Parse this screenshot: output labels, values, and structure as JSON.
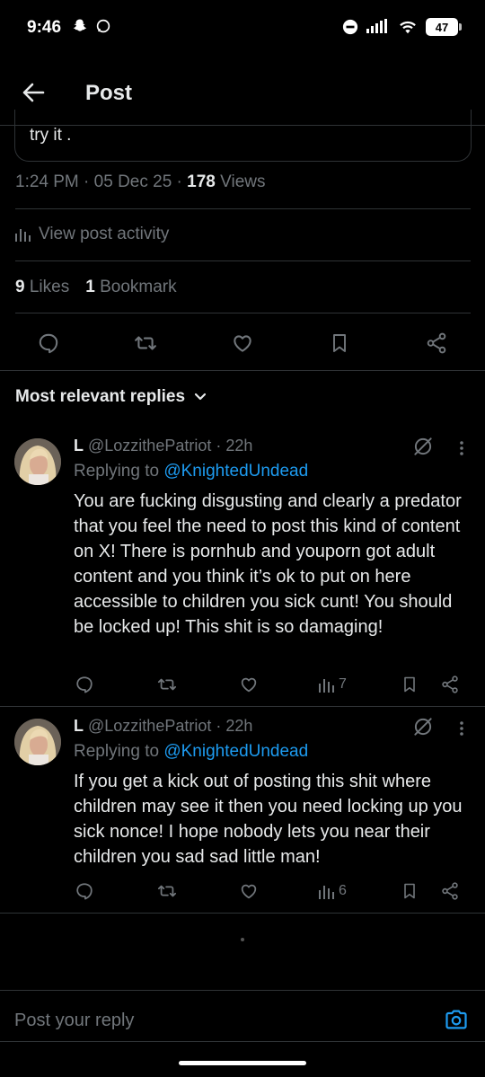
{
  "status_bar": {
    "time": "9:46",
    "battery": "47",
    "icons": [
      "snapchat-icon",
      "messenger-icon",
      "dnd-icon",
      "signal-icon",
      "wifi-icon",
      "battery-icon"
    ]
  },
  "header": {
    "title": "Post"
  },
  "post": {
    "text_tail": "try it .",
    "time": "1:24 PM",
    "date": "05 Dec 25",
    "views_count": "178",
    "views_label": "Views",
    "activity_label": "View post activity",
    "likes_count": "9",
    "likes_label": "Likes",
    "bookmarks_count": "1",
    "bookmarks_label": "Bookmark"
  },
  "replies_section": {
    "sort_label": "Most relevant replies"
  },
  "replies": [
    {
      "name": "L",
      "handle": "@LozzithePatriot",
      "time": "22h",
      "replying_prefix": "Replying to",
      "replying_to": "@KnightedUndead",
      "body": "You are fucking disgusting and clearly a predator that you feel the need to post this kind of content on X! There is pornhub and youporn got adult content and you think it’s ok to put on here accessible to children you sick cunt! You should be locked up! This shit is so damaging!",
      "views": "7"
    },
    {
      "name": "L",
      "handle": "@LozzithePatriot",
      "time": "22h",
      "replying_prefix": "Replying to",
      "replying_to": "@KnightedUndead",
      "body": "If you get a kick out of posting this shit where children may see it then you need locking up you sick nonce! I hope nobody lets you near their children you sad sad little man!",
      "views": "6"
    }
  ],
  "composer": {
    "placeholder": "Post your reply"
  },
  "colors": {
    "background": "#000000",
    "text": "#e7e9ea",
    "muted": "#71767b",
    "accent": "#1d9bf0",
    "divider": "#2f3336"
  }
}
